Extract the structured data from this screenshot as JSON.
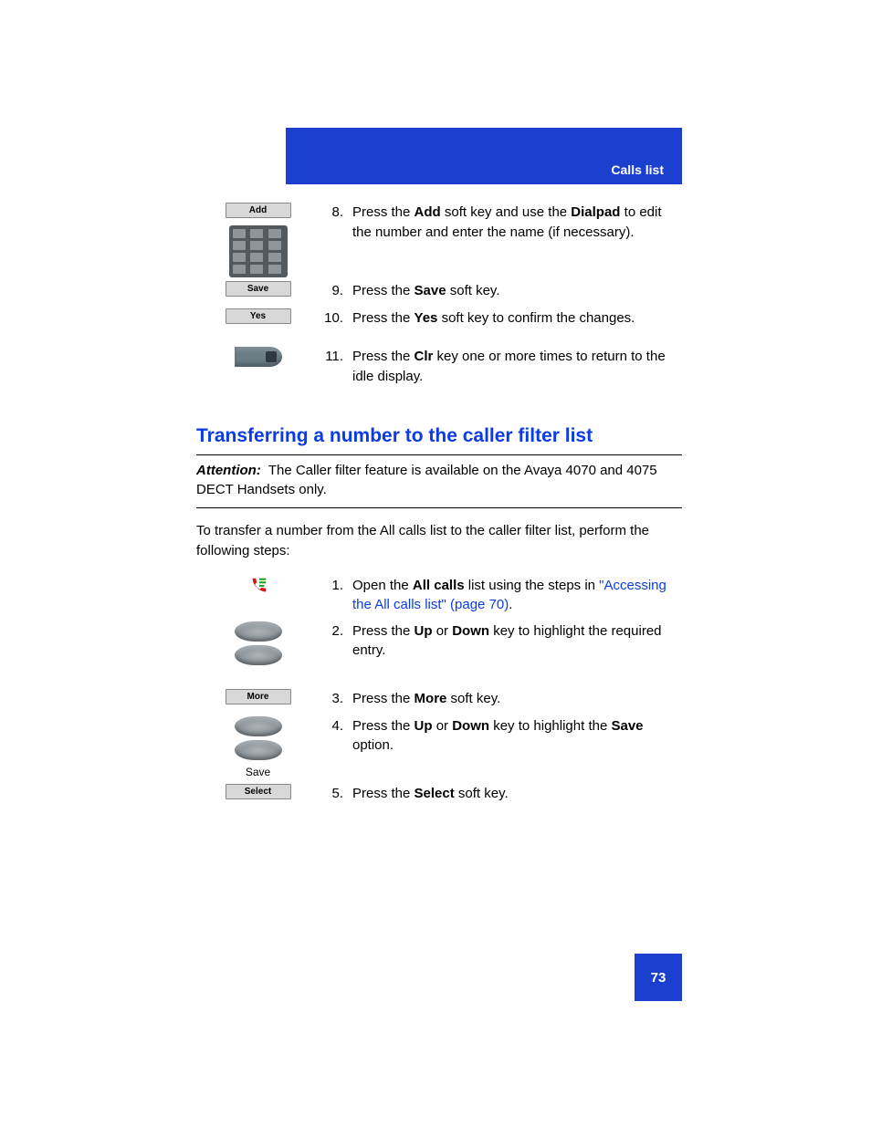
{
  "header": {
    "section_label": "Calls list"
  },
  "top_steps": [
    {
      "num": "8.",
      "icons": [
        {
          "type": "softkey",
          "label": "Add"
        },
        {
          "type": "keypad"
        }
      ],
      "segments": [
        "Press the ",
        {
          "bold": "Add"
        },
        " soft key and use the ",
        {
          "bold": "Dialpad"
        },
        " to edit the number and enter the name (if necessary)."
      ]
    },
    {
      "num": "9.",
      "icons": [
        {
          "type": "softkey",
          "label": "Save"
        }
      ],
      "segments": [
        "Press the ",
        {
          "bold": "Save"
        },
        " soft key."
      ]
    },
    {
      "num": "10.",
      "icons": [
        {
          "type": "softkey",
          "label": "Yes"
        }
      ],
      "segments": [
        "Press the ",
        {
          "bold": "Yes"
        },
        " soft key to confirm the changes."
      ]
    },
    {
      "num": "11.",
      "icons": [
        {
          "type": "clr"
        }
      ],
      "segments": [
        "Press the ",
        {
          "bold": "Clr"
        },
        " key one or more times to return to the idle display."
      ]
    }
  ],
  "section_heading": "Transferring a number to the caller filter list",
  "attention": {
    "label": "Attention:",
    "text": "The Caller filter feature is available on the Avaya 4070 and 4075 DECT Handsets only."
  },
  "intro": "To transfer a number from the All calls list to the caller filter list, perform the following steps:",
  "proc_steps": [
    {
      "num": "1.",
      "icons": [
        {
          "type": "calls"
        }
      ],
      "segments": [
        "Open the ",
        {
          "bold": "All calls"
        },
        " list using the steps in ",
        {
          "link": "\"Accessing the All calls list\" (page 70)"
        },
        "."
      ]
    },
    {
      "num": "2.",
      "icons": [
        {
          "type": "nav"
        },
        {
          "type": "nav"
        }
      ],
      "segments": [
        "Press the ",
        {
          "bold": "Up"
        },
        " or ",
        {
          "bold": "Down"
        },
        " key to highlight the required entry."
      ]
    },
    {
      "num": "3.",
      "icons": [
        {
          "type": "softkey",
          "label": "More"
        }
      ],
      "segments": [
        "Press the ",
        {
          "bold": "More"
        },
        " soft key."
      ]
    },
    {
      "num": "4.",
      "icons": [
        {
          "type": "nav"
        },
        {
          "type": "nav"
        },
        {
          "type": "option",
          "label": "Save"
        }
      ],
      "segments": [
        "Press the ",
        {
          "bold": "Up"
        },
        " or ",
        {
          "bold": "Down"
        },
        " key to highlight the ",
        {
          "bold": "Save"
        },
        " option."
      ]
    },
    {
      "num": "5.",
      "icons": [
        {
          "type": "softkey",
          "label": "Select"
        }
      ],
      "segments": [
        "Press the ",
        {
          "bold": "Select"
        },
        " soft key."
      ]
    }
  ],
  "page_number": "73"
}
